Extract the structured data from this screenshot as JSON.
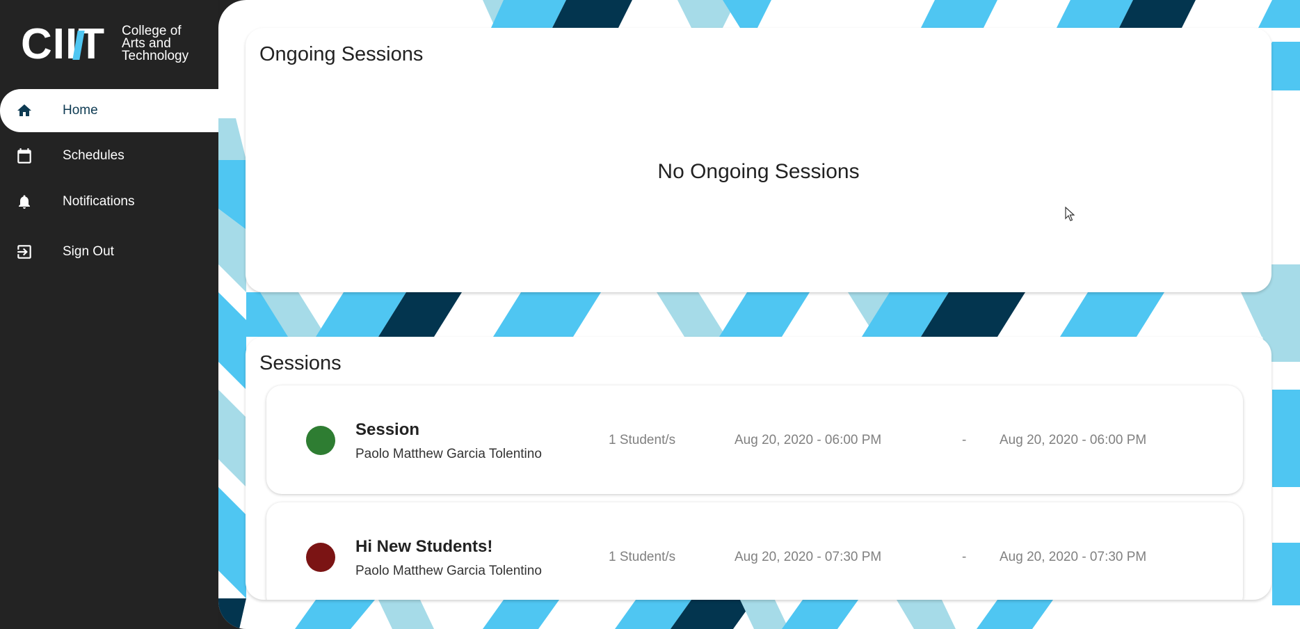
{
  "logo": {
    "mark": "CIIT",
    "text_lines": [
      "College of",
      "Arts and",
      "Technology"
    ]
  },
  "sidebar": {
    "items": [
      {
        "label": "Home",
        "icon": "home-icon",
        "active": true
      },
      {
        "label": "Schedules",
        "icon": "calendar-icon",
        "active": false
      },
      {
        "label": "Notifications",
        "icon": "bell-icon",
        "active": false
      },
      {
        "label": "Sign Out",
        "icon": "sign-out-icon",
        "active": false
      }
    ]
  },
  "ongoing": {
    "title": "Ongoing Sessions",
    "empty_message": "No Ongoing Sessions"
  },
  "sessions": {
    "title": "Sessions",
    "items": [
      {
        "title": "Session",
        "host": "Paolo Matthew Garcia Tolentino",
        "students": "1 Student/s",
        "start": "Aug 20, 2020 - 06:00 PM",
        "separator": "-",
        "end": "Aug 20, 2020 - 06:00 PM",
        "status_color": "#2e7d32"
      },
      {
        "title": "Hi New Students!",
        "host": "Paolo Matthew Garcia Tolentino",
        "students": "1 Student/s",
        "start": "Aug 20, 2020 - 07:30 PM",
        "separator": "-",
        "end": "Aug 20, 2020 - 07:30 PM",
        "status_color": "#7b1414"
      }
    ]
  },
  "colors": {
    "sidebar_bg": "#232323",
    "active_text": "#0d3a52",
    "stripe_light": "#4fc6f2",
    "stripe_pale": "#a6dbe8",
    "stripe_dark": "#03354f"
  }
}
